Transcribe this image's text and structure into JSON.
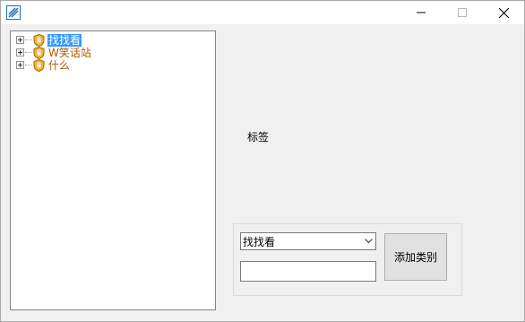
{
  "tree": {
    "items": [
      {
        "label": "找找看",
        "selected": true
      },
      {
        "label": "W笑话站",
        "selected": false
      },
      {
        "label": "什么",
        "selected": false
      }
    ]
  },
  "main": {
    "label_text": "标签",
    "category_select": {
      "value": "找找看"
    },
    "category_input": {
      "value": "",
      "placeholder": ""
    },
    "add_button_label": "添加类别"
  },
  "icons": {
    "app": "app-icon",
    "node": "shield-icon",
    "expander": "plus-box-icon",
    "minimize": "minimize-icon",
    "maximize": "maximize-icon",
    "close": "close-icon",
    "dropdown": "chevron-down-icon"
  },
  "colors": {
    "selection": "#3399ff",
    "node_text": "#b05a00",
    "window_bg": "#f0f0f0"
  }
}
